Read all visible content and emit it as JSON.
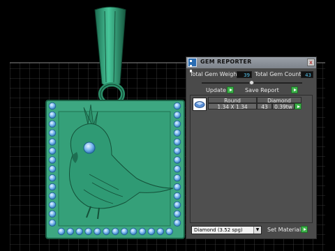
{
  "panel": {
    "title": "GEM REPORTER",
    "close_symbol": "x",
    "total_weight_label": "Total Gem Weight",
    "total_weight_value": "39",
    "total_count_label": "Total Gem Count",
    "total_count_value": "43",
    "update_label": "Update",
    "save_report_label": "Save Report",
    "gem_row": {
      "shape": "Round",
      "size": "1.34 X 1.34",
      "material": "Diamond",
      "count": "43",
      "weight": "0.39tw"
    },
    "material_select": "Diamond  (3.52 spg)",
    "set_material_label": "Set Material"
  },
  "colors": {
    "model_green": "#2f9a74",
    "gem_blue": "#7ab8ee",
    "panel_bg": "#4a4a4a",
    "accent_green": "#3db24a",
    "value_text": "#5ac8f0"
  },
  "icons": [
    "gem-reporter-icon",
    "close-icon",
    "play-icon",
    "gem-thumbnail-icon",
    "dropdown-arrow-icon"
  ]
}
